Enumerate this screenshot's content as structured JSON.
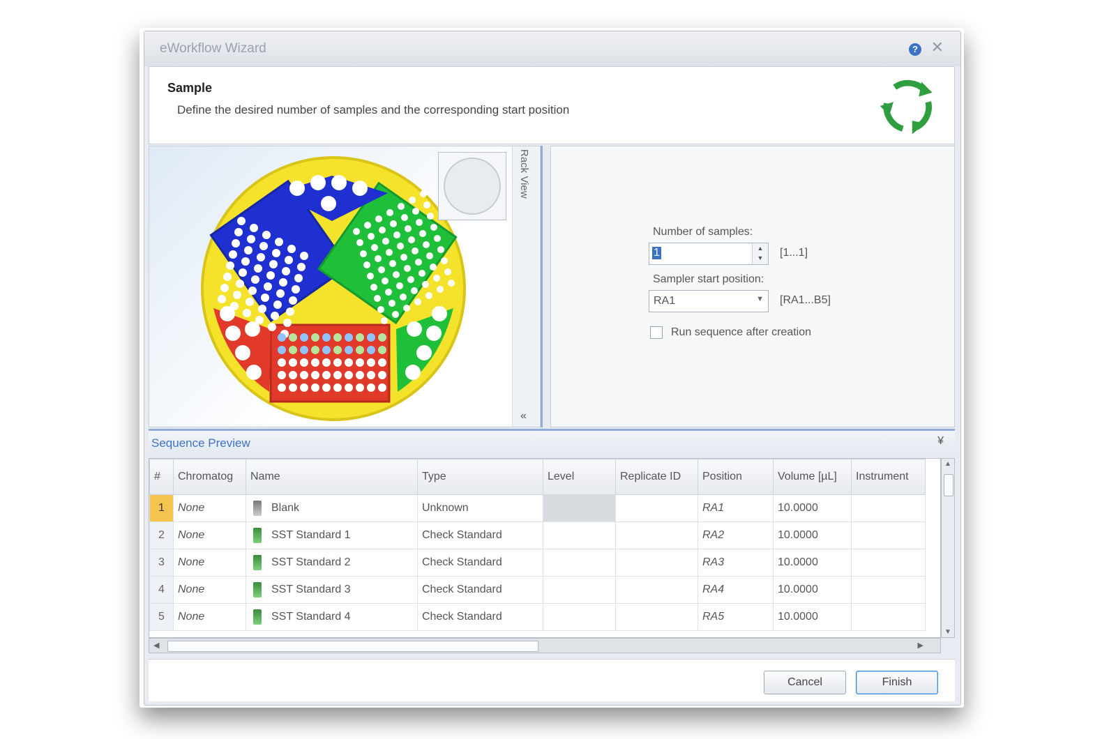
{
  "window": {
    "title": "eWorkflow Wizard",
    "help_label": "?",
    "close_label": "✕"
  },
  "header": {
    "title": "Sample",
    "description": "Define the desired number of samples and the corresponding start position"
  },
  "rack": {
    "tab_label": "Rack View",
    "collapse_label": "«"
  },
  "form": {
    "num_samples_label": "Number of samples:",
    "num_samples_value": "1",
    "num_samples_range": "[1...1]",
    "start_position_label": "Sampler start position:",
    "start_position_value": "RA1",
    "start_position_range": "[RA1...B5]",
    "run_sequence_label": "Run sequence after creation",
    "run_sequence_checked": false
  },
  "sequence": {
    "title": "Sequence Preview",
    "toggle_label": "¥",
    "columns": [
      "#",
      "Chromatog",
      "Name",
      "Type",
      "Level",
      "Replicate ID",
      "Position",
      "Volume [µL]",
      "Instrument"
    ],
    "rows": [
      {
        "num": "1",
        "chromatogram": "None",
        "name": "Blank",
        "type": "Unknown",
        "level": "",
        "replicate": "",
        "position": "RA1",
        "volume": "10.0000",
        "instrument": ""
      },
      {
        "num": "2",
        "chromatogram": "None",
        "name": "SST Standard 1",
        "type": "Check Standard",
        "level": "",
        "replicate": "",
        "position": "RA2",
        "volume": "10.0000",
        "instrument": ""
      },
      {
        "num": "3",
        "chromatogram": "None",
        "name": "SST Standard 2",
        "type": "Check Standard",
        "level": "",
        "replicate": "",
        "position": "RA3",
        "volume": "10.0000",
        "instrument": ""
      },
      {
        "num": "4",
        "chromatogram": "None",
        "name": "SST Standard 3",
        "type": "Check Standard",
        "level": "",
        "replicate": "",
        "position": "RA4",
        "volume": "10.0000",
        "instrument": ""
      },
      {
        "num": "5",
        "chromatogram": "None",
        "name": "SST Standard 4",
        "type": "Check Standard",
        "level": "",
        "replicate": "",
        "position": "RA5",
        "volume": "10.0000",
        "instrument": ""
      }
    ]
  },
  "footer": {
    "cancel_label": "Cancel",
    "finish_label": "Finish"
  },
  "colors": {
    "accent": "#3d73c6",
    "selected_row": "#f4c44f",
    "rack_blue": "#1f2fd0",
    "rack_green": "#1fbf3a",
    "rack_red": "#e23a2a",
    "carousel_yellow": "#f5e22a"
  },
  "icons": [
    "help-icon",
    "close-icon",
    "recycle-icon",
    "vial-icon",
    "chevron-down-icon"
  ]
}
